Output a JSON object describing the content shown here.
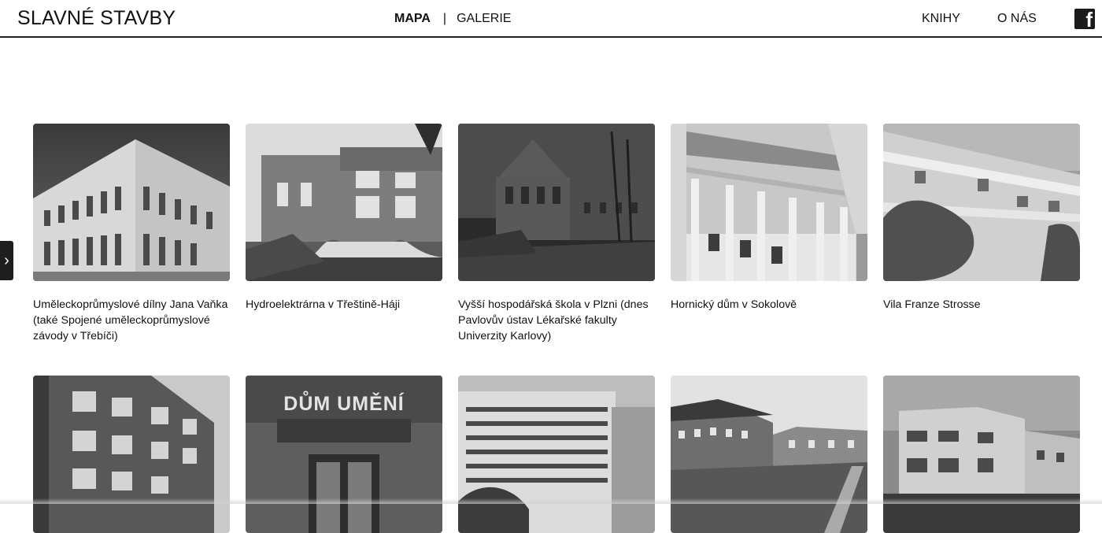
{
  "header": {
    "logo": "SLAVNÉ STAVBY",
    "nav_map": "MAPA",
    "nav_separator": "|",
    "nav_gallery": "GALERIE",
    "nav_books": "KNIHY",
    "nav_about": "O NÁS",
    "social_icon": "facebook-icon"
  },
  "sidebar": {
    "expand_icon": "chevron-right-icon",
    "expand_glyph": "›"
  },
  "gallery": {
    "row1": [
      {
        "title": "Uměleckoprůmyslové dílny Jana Vaňka (také Spojené uměleckoprůmyslové závody v Třebíči)"
      },
      {
        "title": "Hydroelektrárna v Třeštině-Háji"
      },
      {
        "title": "Vyšší hospodářská škola v Plzni (dnes Pavlovův ústav Lékařské fakulty Univerzity Karlovy)"
      },
      {
        "title": "Hornický dům v Sokolově"
      },
      {
        "title": "Vila Franze Strosse"
      }
    ],
    "row2_images": [
      {
        "photo_sign": "DŮM UMĚNÍ"
      }
    ]
  },
  "colors": {
    "header_border": "#222222",
    "text": "#111111",
    "facebook_bg": "#1b1b1b"
  }
}
